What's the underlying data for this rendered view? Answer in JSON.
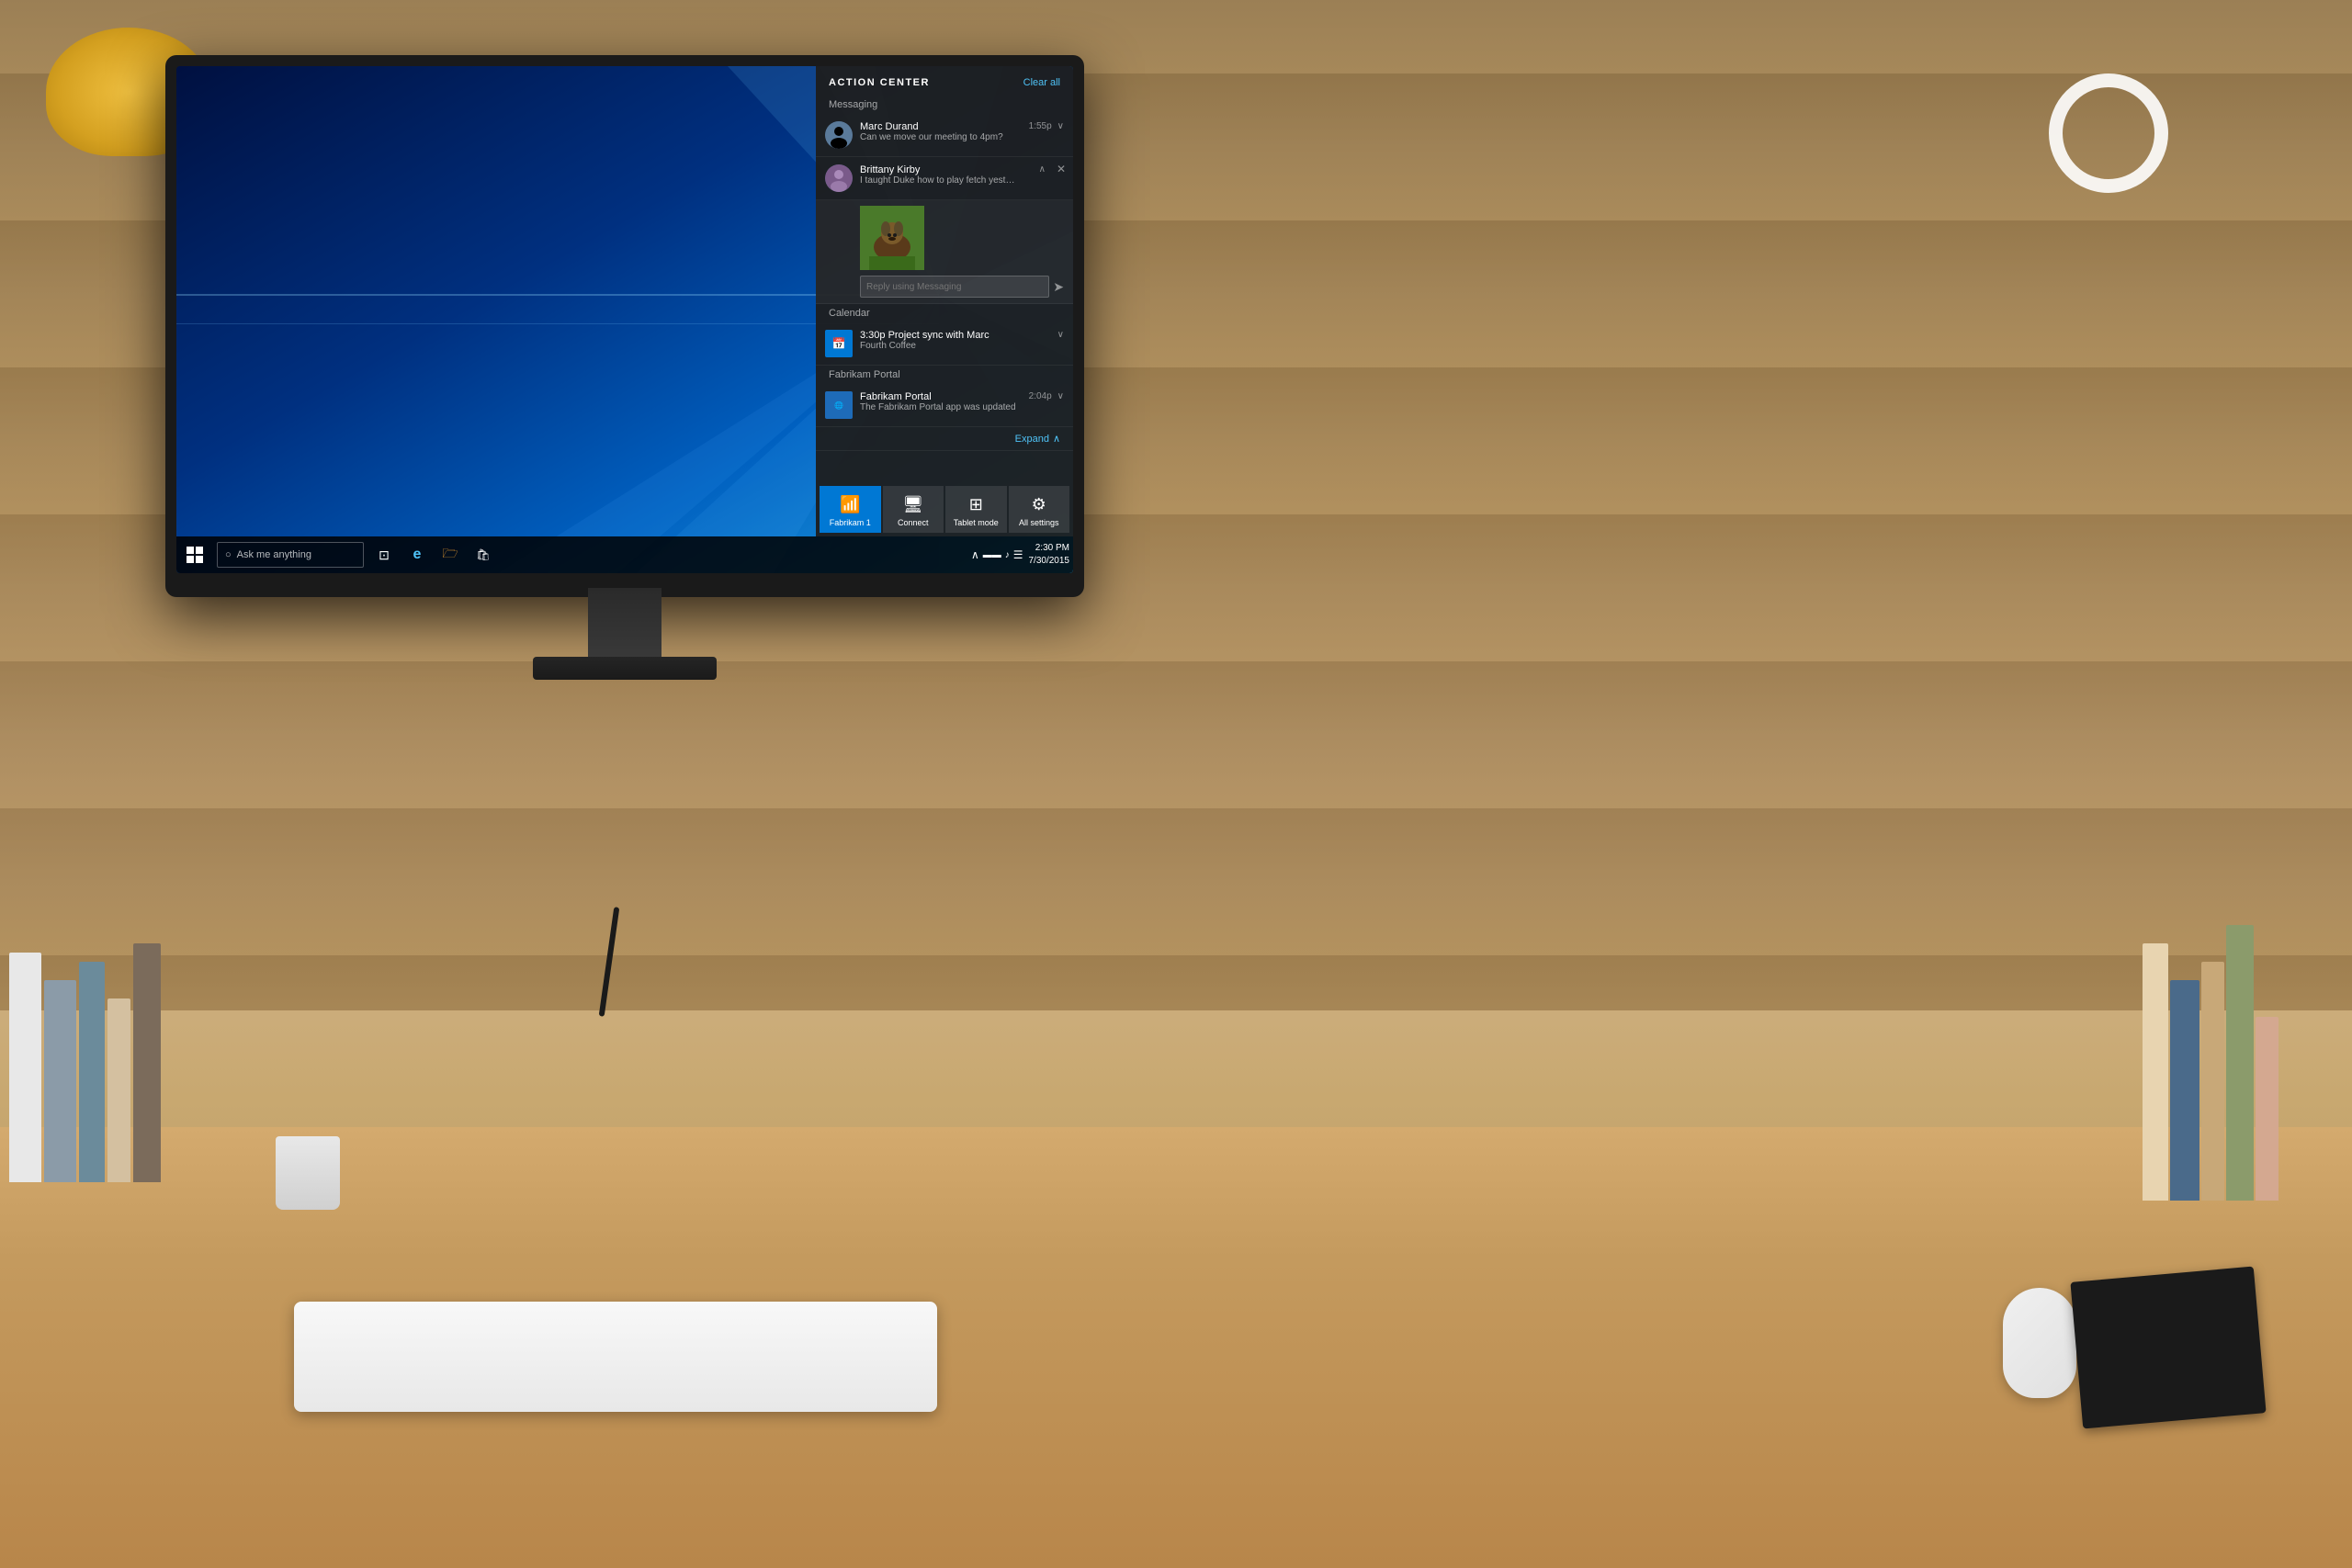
{
  "room": {
    "desk_color": "#D4AA6E",
    "wall_color": "#9B7A4A"
  },
  "action_center": {
    "title": "ACTION CENTER",
    "clear_all_label": "Clear all",
    "expand_label": "Expand",
    "sections": {
      "messaging_label": "Messaging",
      "calendar_label": "Calendar",
      "fabrikam_label": "Fabrikam Portal"
    },
    "notifications": [
      {
        "id": "msg1",
        "app": "Messaging",
        "sender": "Marc Durand",
        "message": "Can we move our meeting to 4pm?",
        "time": "1:55p",
        "expanded": false
      },
      {
        "id": "msg2",
        "app": "Messaging",
        "sender": "Brittany Kirby",
        "message": "I taught Duke how to play fetch yesterday!",
        "time": "",
        "expanded": true,
        "has_image": true,
        "reply_placeholder": "Reply using Messaging"
      },
      {
        "id": "cal1",
        "app": "Calendar",
        "title": "3:30p  Project sync with Marc",
        "subtitle": "Fourth Coffee",
        "time": "",
        "expanded": false
      },
      {
        "id": "fab1",
        "app": "Fabrikam Portal",
        "sender": "Fabrikam Portal",
        "message": "The Fabrikam Portal app was updated",
        "time": "2:04p",
        "expanded": false
      }
    ],
    "quick_actions": [
      {
        "id": "qa1",
        "label": "Fabrikam 1",
        "icon": "📶",
        "active": true
      },
      {
        "id": "qa2",
        "label": "Connect",
        "icon": "🖥",
        "active": false
      },
      {
        "id": "qa3",
        "label": "Tablet mode",
        "icon": "⊞",
        "active": false
      },
      {
        "id": "qa4",
        "label": "All settings",
        "icon": "⚙",
        "active": false
      }
    ]
  },
  "taskbar": {
    "search_placeholder": "Ask me anything",
    "clock_time": "2:30 PM",
    "clock_date": "7/30/2015",
    "start_button_label": "Start",
    "task_view_label": "Task View",
    "cortana_label": "Cortana",
    "edge_label": "Microsoft Edge",
    "explorer_label": "File Explorer",
    "store_label": "Microsoft Store"
  }
}
